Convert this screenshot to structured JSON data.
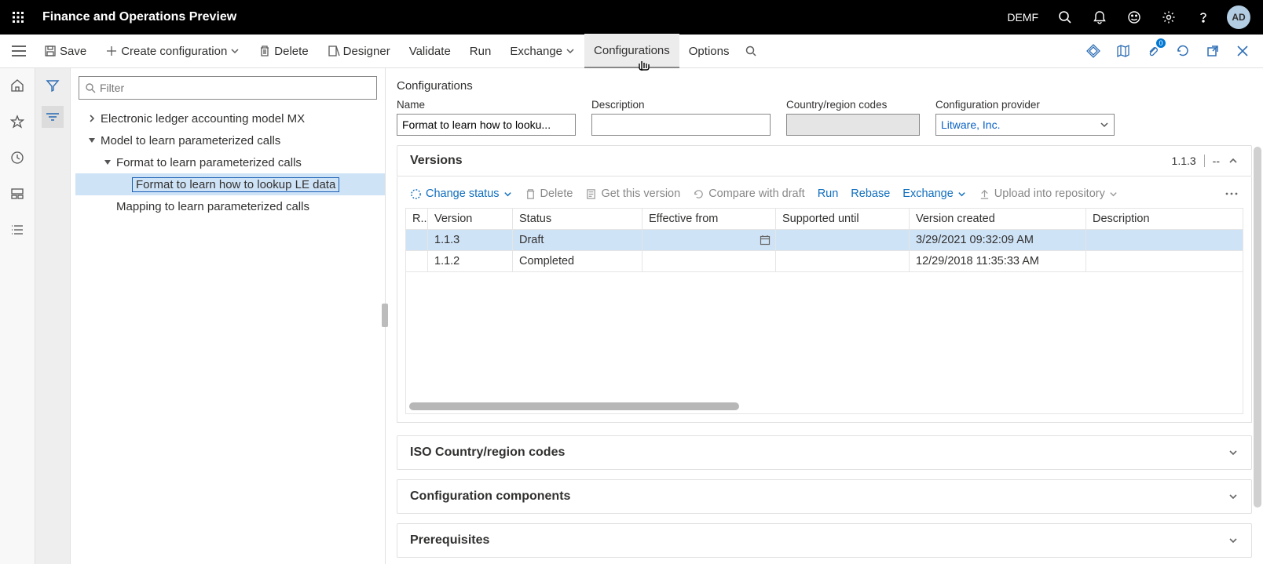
{
  "topbar": {
    "app_title": "Finance and Operations Preview",
    "company": "DEMF",
    "avatar_initials": "AD"
  },
  "commands": {
    "save": "Save",
    "create_config": "Create configuration",
    "delete": "Delete",
    "designer": "Designer",
    "validate": "Validate",
    "run": "Run",
    "exchange": "Exchange",
    "configurations": "Configurations",
    "options": "Options",
    "attachments_count": "0"
  },
  "filter": {
    "placeholder": "Filter"
  },
  "tree": {
    "root1": "Electronic ledger accounting model MX",
    "root2": "Model to learn parameterized calls",
    "child1": "Format to learn parameterized calls",
    "child1a": "Format to learn how to lookup LE data",
    "child2": "Mapping to learn parameterized calls"
  },
  "content": {
    "title": "Configurations",
    "fields": {
      "name_label": "Name",
      "name_value": "Format to learn how to looku...",
      "desc_label": "Description",
      "desc_value": "",
      "country_label": "Country/region codes",
      "country_value": "",
      "provider_label": "Configuration provider",
      "provider_value": "Litware, Inc."
    }
  },
  "versions": {
    "header": "Versions",
    "summary": "1.1.3",
    "summary_extra": "--",
    "toolbar": {
      "change_status": "Change status",
      "delete": "Delete",
      "get": "Get this version",
      "compare": "Compare with draft",
      "run": "Run",
      "rebase": "Rebase",
      "exchange": "Exchange",
      "upload": "Upload into repository"
    },
    "columns": {
      "r": "R...",
      "version": "Version",
      "status": "Status",
      "eff": "Effective from",
      "sup": "Supported until",
      "created": "Version created",
      "desc": "Description"
    },
    "rows": [
      {
        "version": "1.1.3",
        "status": "Draft",
        "eff": "",
        "sup": "",
        "created": "3/29/2021 09:32:09 AM",
        "desc": ""
      },
      {
        "version": "1.1.2",
        "status": "Completed",
        "eff": "",
        "sup": "",
        "created": "12/29/2018 11:35:33 AM",
        "desc": ""
      }
    ]
  },
  "sections": {
    "iso": "ISO Country/region codes",
    "components": "Configuration components",
    "prereq": "Prerequisites"
  }
}
